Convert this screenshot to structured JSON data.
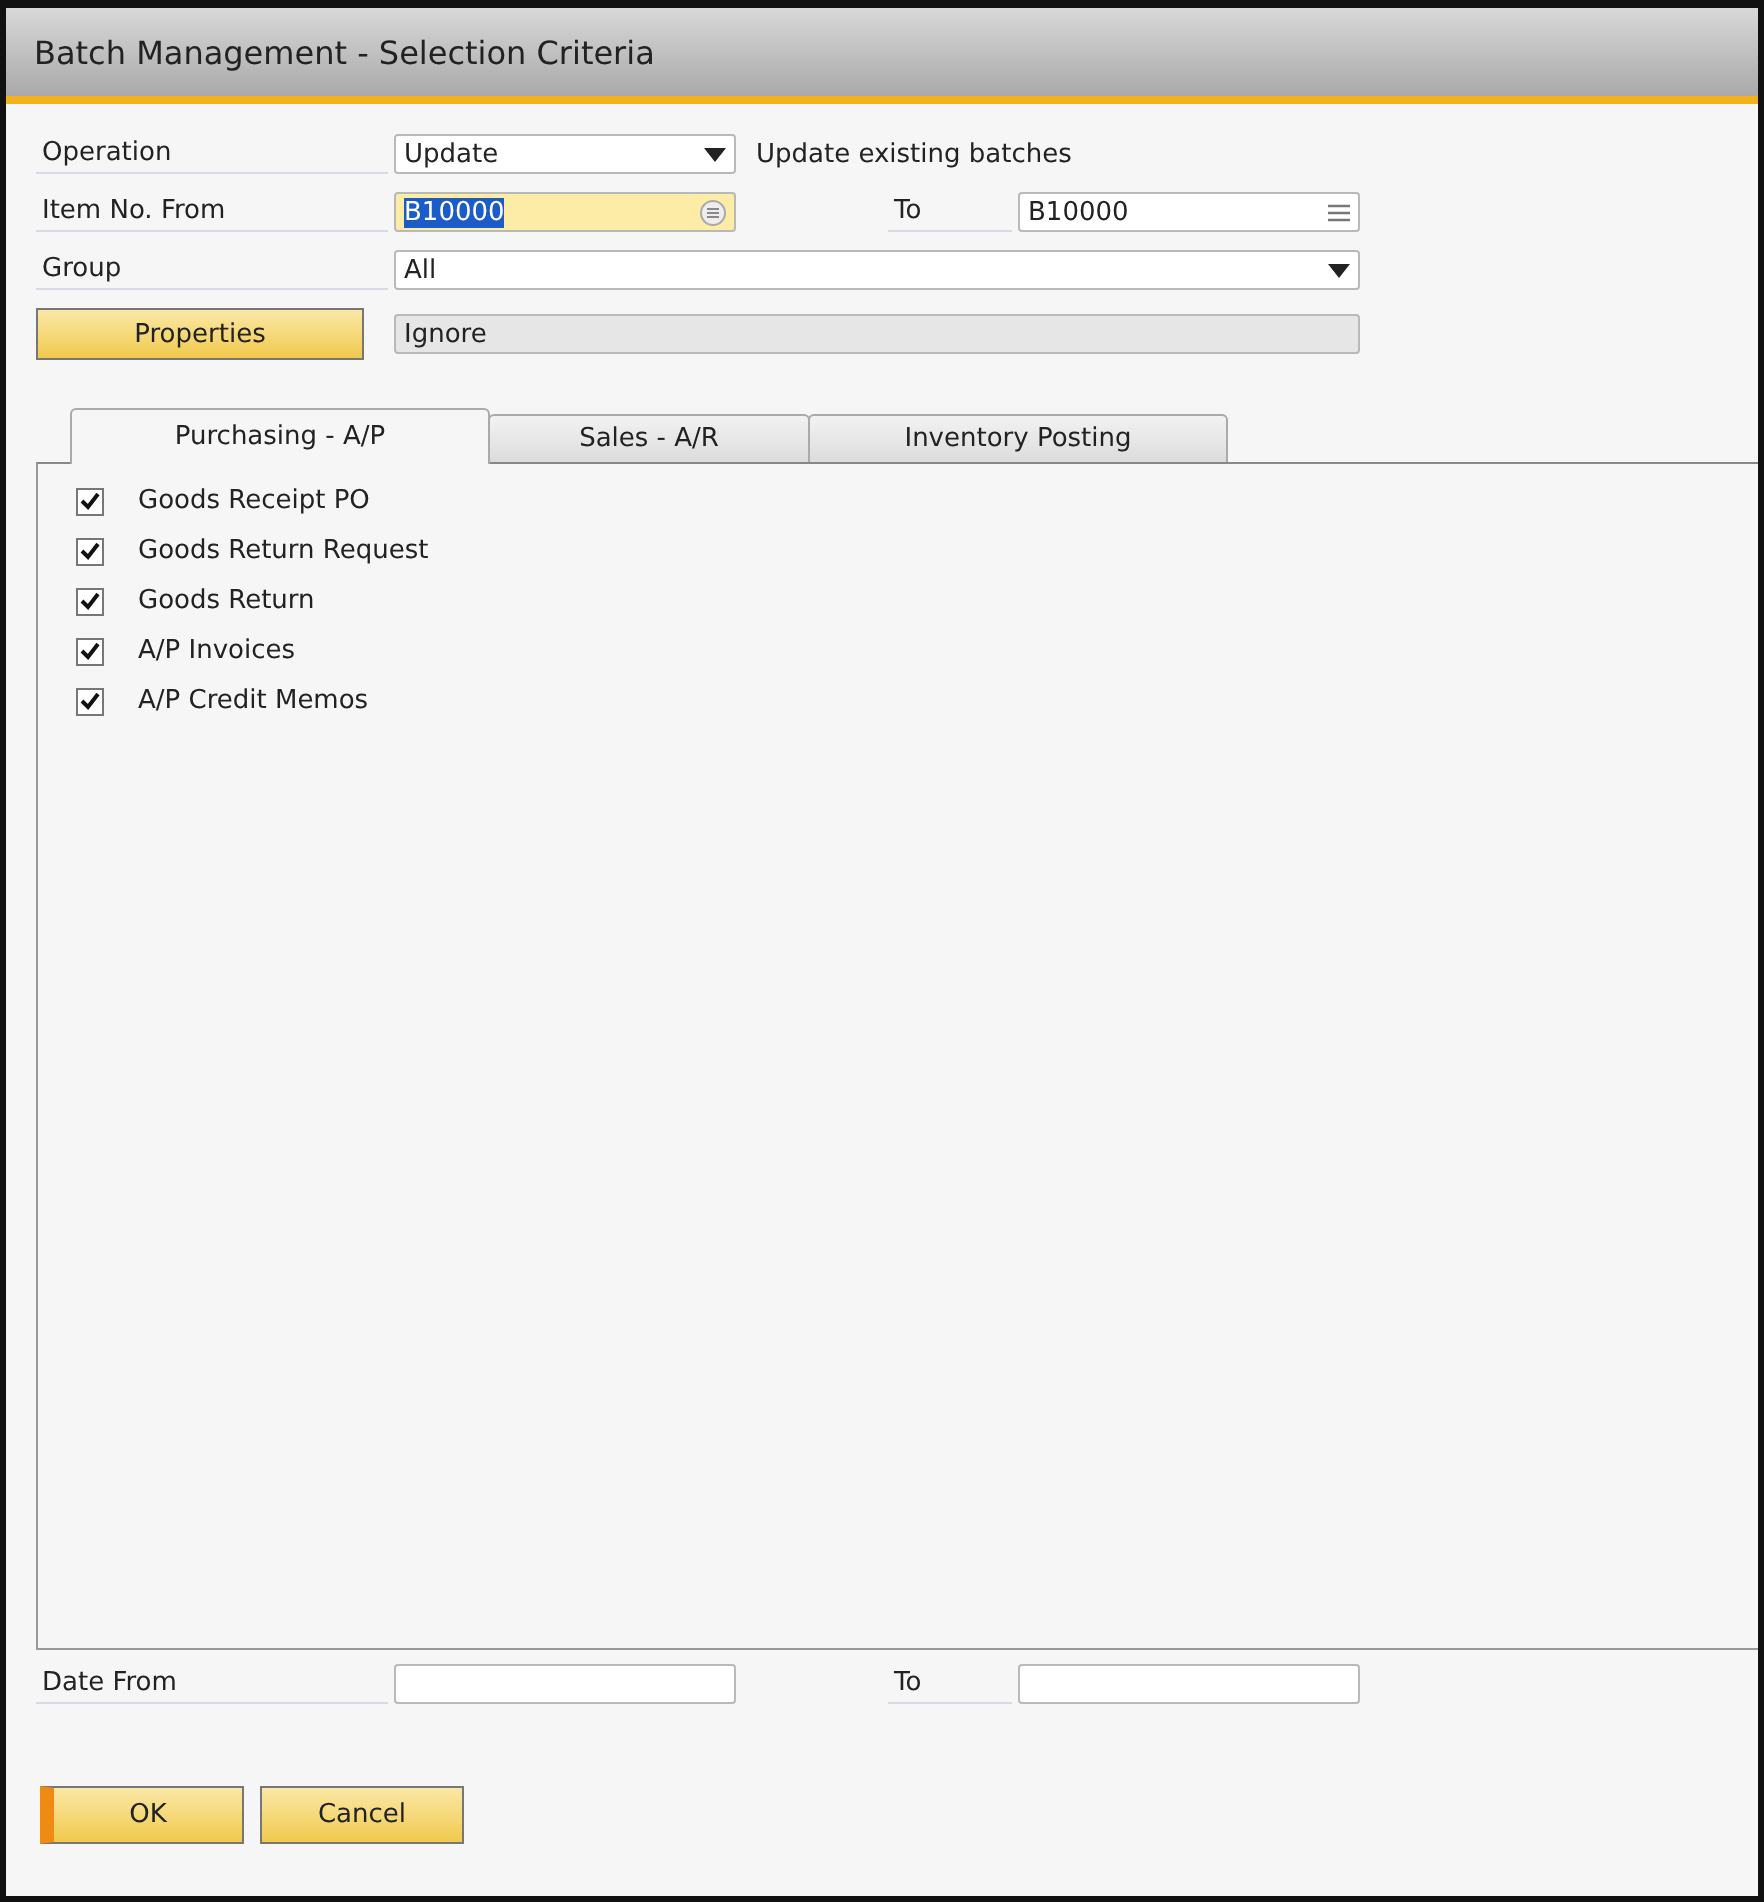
{
  "window": {
    "title": "Batch Management - Selection Criteria"
  },
  "operation": {
    "label": "Operation",
    "value": "Update",
    "description": "Update existing batches"
  },
  "item_no": {
    "label": "Item No. From",
    "from": {
      "value": "B10000",
      "focused": true,
      "text_selected": true
    },
    "to_label": "To",
    "to": {
      "value": "B10000",
      "focused": false,
      "text_selected": false
    }
  },
  "group": {
    "label": "Group",
    "value": "All"
  },
  "properties": {
    "button": "Properties",
    "value": "Ignore"
  },
  "tabs": [
    {
      "label": "Purchasing - A/P",
      "selected": true
    },
    {
      "label": "Sales - A/R",
      "selected": false
    },
    {
      "label": "Inventory Posting",
      "selected": false
    }
  ],
  "documents": [
    {
      "label": "Goods Receipt PO",
      "checked": true
    },
    {
      "label": "Goods Return Request",
      "checked": true
    },
    {
      "label": "Goods Return",
      "checked": true
    },
    {
      "label": "A/P Invoices",
      "checked": true
    },
    {
      "label": "A/P Credit Memos",
      "checked": true
    }
  ],
  "date": {
    "label": "Date From",
    "to_label": "To"
  },
  "buttons": [
    {
      "label": "OK",
      "default": true
    },
    {
      "label": "Cancel",
      "default": false
    }
  ]
}
